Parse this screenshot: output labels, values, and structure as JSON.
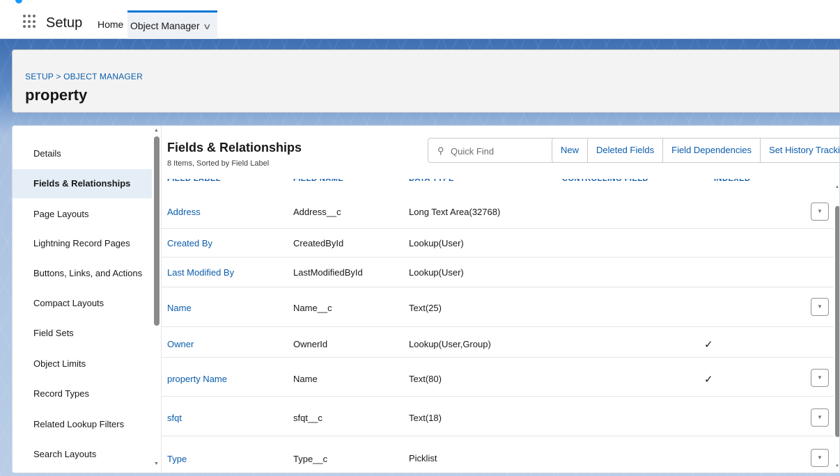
{
  "app": {
    "name": "Setup",
    "tabs": [
      {
        "label": "Home"
      },
      {
        "label": "Object Manager"
      }
    ]
  },
  "header": {
    "breadcrumb": "SETUP > OBJECT MANAGER",
    "title": "property"
  },
  "sidebar": {
    "items": [
      {
        "label": "Details",
        "active": false
      },
      {
        "label": "Fields & Relationships",
        "active": true
      },
      {
        "label": "Page Layouts",
        "active": false
      },
      {
        "label": "Lightning Record Pages",
        "active": false
      },
      {
        "label": "Buttons, Links, and Actions",
        "active": false
      },
      {
        "label": "Compact Layouts",
        "active": false
      },
      {
        "label": "Field Sets",
        "active": false
      },
      {
        "label": "Object Limits",
        "active": false
      },
      {
        "label": "Record Types",
        "active": false
      },
      {
        "label": "Related Lookup Filters",
        "active": false
      },
      {
        "label": "Search Layouts",
        "active": false
      }
    ]
  },
  "section": {
    "title": "Fields & Relationships",
    "subtitle": "8 Items, Sorted by Field Label",
    "search": {
      "placeholder": "Quick Find",
      "value": "",
      "icon": "search-icon"
    },
    "buttons": [
      "New",
      "Deleted Fields",
      "Field Dependencies",
      "Set History Tracking"
    ]
  },
  "table": {
    "columns": [
      "FIELD LABEL",
      "FIELD NAME",
      "DATA TYPE",
      "CONTROLLING FIELD",
      "INDEXED"
    ],
    "rows": [
      {
        "label": "Address",
        "api": "Address__c",
        "type": "Long Text Area(32768)",
        "controlling": "",
        "indexed": "",
        "action": true
      },
      {
        "label": "Created By",
        "api": "CreatedById",
        "type": "Lookup(User)",
        "controlling": "",
        "indexed": "",
        "action": false
      },
      {
        "label": "Last Modified By",
        "api": "LastModifiedById",
        "type": "Lookup(User)",
        "controlling": "",
        "indexed": "",
        "action": false
      },
      {
        "label": "Name",
        "api": "Name__c",
        "type": "Text(25)",
        "controlling": "",
        "indexed": "",
        "action": true
      },
      {
        "label": "Owner",
        "api": "OwnerId",
        "type": "Lookup(User,Group)",
        "controlling": "",
        "indexed": "✓",
        "action": false
      },
      {
        "label": "property Name",
        "api": "Name",
        "type": "Text(80)",
        "controlling": "",
        "indexed": "✓",
        "action": true
      },
      {
        "label": "sfqt",
        "api": "sfqt__c",
        "type": "Text(18)",
        "controlling": "",
        "indexed": "",
        "action": true
      },
      {
        "label": "Type",
        "api": "Type__c",
        "type": "Picklist",
        "controlling": "",
        "indexed": "",
        "action": true
      }
    ]
  },
  "icons": {
    "app_launcher": "waffle-icon",
    "tab_menu": "chevron-down-icon",
    "row_action": "caret-down-icon",
    "checkmark": "check-icon"
  },
  "colors": {
    "link": "#0b5cab",
    "brand_blue": "#0176d3",
    "active_nav": "#e5edf7"
  }
}
